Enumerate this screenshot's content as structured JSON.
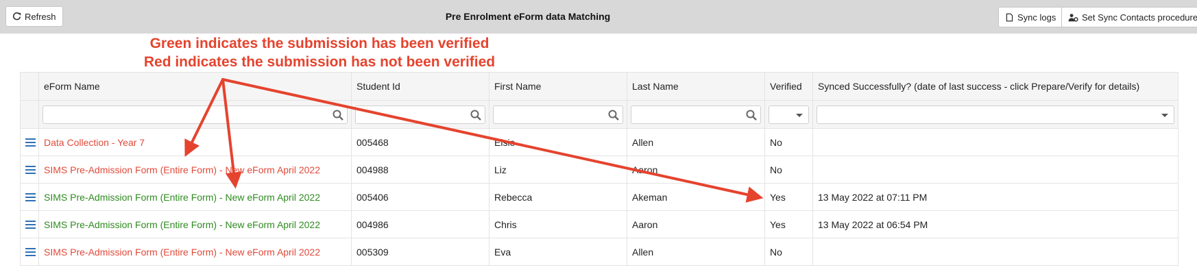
{
  "toolbar": {
    "refresh_label": "Refresh",
    "title": "Pre Enrolment eForm data Matching",
    "sync_logs_label": "Sync logs",
    "set_sync_label": "Set Sync Contacts procedure"
  },
  "annotation": {
    "line1": "Green indicates the submission has been verified",
    "line2": "Red indicates the submission has not been verified",
    "color": "#e5432e"
  },
  "columns": {
    "eform_name": "eForm Name",
    "student_id": "Student Id",
    "first_name": "First Name",
    "last_name": "Last Name",
    "verified": "Verified",
    "synced": "Synced Successfully? (date of last success - click Prepare/Verify for details)"
  },
  "status_colors": {
    "verified": "#2e8b1f",
    "not_verified": "#e04a3a"
  },
  "rows": [
    {
      "eform": "Data Collection - Year 7",
      "student_id": "005468",
      "first": "Elsie",
      "last": "Allen",
      "verified": "No",
      "synced": ""
    },
    {
      "eform": "SIMS Pre-Admission Form (Entire Form) - New eForm April 2022",
      "student_id": "004988",
      "first": "Liz",
      "last": "Aaron",
      "verified": "No",
      "synced": ""
    },
    {
      "eform": "SIMS Pre-Admission Form (Entire Form) - New eForm April 2022",
      "student_id": "005406",
      "first": "Rebecca",
      "last": "Akeman",
      "verified": "Yes",
      "synced": "13 May 2022 at 07:11 PM"
    },
    {
      "eform": "SIMS Pre-Admission Form (Entire Form) - New eForm April 2022",
      "student_id": "004986",
      "first": "Chris",
      "last": "Aaron",
      "verified": "Yes",
      "synced": "13 May 2022 at 06:54 PM"
    },
    {
      "eform": "SIMS Pre-Admission Form (Entire Form) - New eForm April 2022",
      "student_id": "005309",
      "first": "Eva",
      "last": "Allen",
      "verified": "No",
      "synced": ""
    }
  ]
}
